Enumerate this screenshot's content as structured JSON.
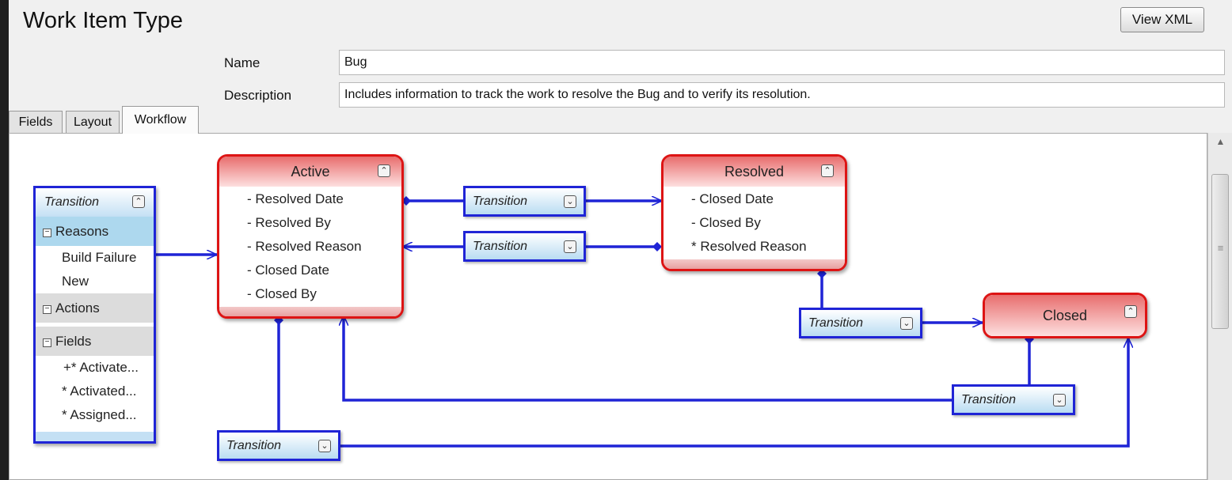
{
  "header": {
    "title": "Work Item Type",
    "view_xml_label": "View XML"
  },
  "form": {
    "name_label": "Name",
    "name_value": "Bug",
    "description_label": "Description",
    "description_value": "Includes information to track the work to resolve the Bug and to verify its resolution."
  },
  "tabs": [
    {
      "label": "Fields",
      "active": false
    },
    {
      "label": "Layout",
      "active": false
    },
    {
      "label": "Workflow",
      "active": true
    }
  ],
  "workflow": {
    "states": [
      {
        "name": "Active",
        "fields": [
          "- Resolved Date",
          "- Resolved By",
          "- Resolved Reason",
          "- Closed Date",
          "- Closed By"
        ]
      },
      {
        "name": "Resolved",
        "fields": [
          "- Closed Date",
          "- Closed By",
          "* Resolved Reason"
        ]
      },
      {
        "name": "Closed",
        "fields": []
      }
    ],
    "transition_label": "Transition",
    "expanded_transition": {
      "label": "Transition",
      "sections": [
        {
          "label": "Reasons",
          "items": [
            "Build Failure",
            "New"
          ]
        },
        {
          "label": "Actions",
          "items": []
        },
        {
          "label": "Fields",
          "items": [
            "+* Activate...",
            "* Activated...",
            "* Assigned..."
          ]
        }
      ]
    }
  },
  "colors": {
    "state_border": "#dd1414",
    "transition_border": "#1f24d6",
    "connector": "#1f24d6"
  }
}
